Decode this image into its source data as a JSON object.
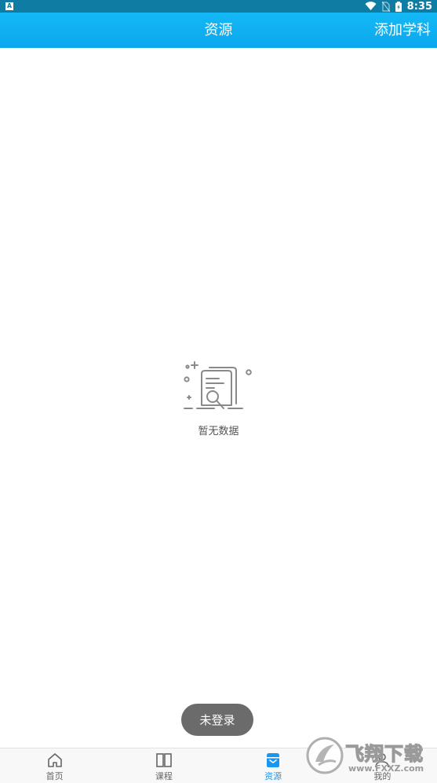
{
  "status_bar": {
    "notif_letter": "A",
    "time": "8:35"
  },
  "header": {
    "title": "资源",
    "action_label": "添加学科"
  },
  "empty_state": {
    "message": "暂无数据",
    "icon": "document-search-icon"
  },
  "toast": {
    "message": "未登录"
  },
  "bottom_nav": {
    "items": [
      {
        "label": "首页",
        "icon": "home-icon",
        "active": false
      },
      {
        "label": "课程",
        "icon": "book-icon",
        "active": false
      },
      {
        "label": "资源",
        "icon": "inbox-icon",
        "active": true
      },
      {
        "label": "我的",
        "icon": "user-icon",
        "active": false
      }
    ]
  },
  "watermark": {
    "brand": "飞翔下载",
    "url": "www.FXXZ.com"
  },
  "colors": {
    "header": "#0aa7ee",
    "status_bar": "#0f7ca4",
    "active_tab": "#1797f0"
  }
}
